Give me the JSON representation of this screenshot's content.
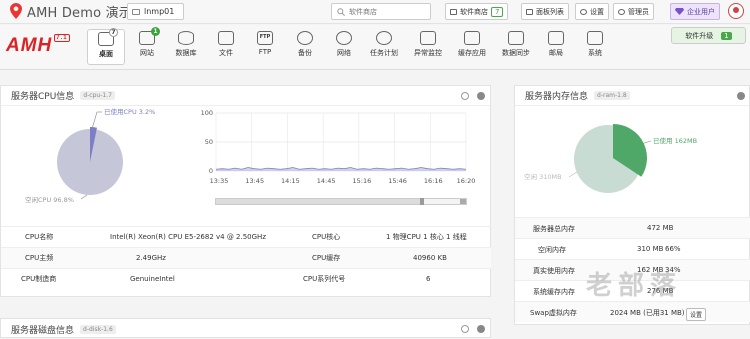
{
  "brand": {
    "title": "AMH Demo 演示"
  },
  "host_select": {
    "value": "lnmp01"
  },
  "search": {
    "placeholder": "软件商店"
  },
  "top_buttons": {
    "store": "软件商店",
    "store_badge": "7",
    "panel_list": "面板列表",
    "settings": "设置",
    "admin": "管理员",
    "enterprise": "企业用户"
  },
  "logo": {
    "text": "AMH",
    "version": "7.1"
  },
  "nav": [
    {
      "label": "桌面",
      "badge": "7"
    },
    {
      "label": "网站",
      "badge": "1"
    },
    {
      "label": "数据库"
    },
    {
      "label": "文件"
    },
    {
      "label": "FTP"
    },
    {
      "label": "备份"
    },
    {
      "label": "网络"
    },
    {
      "label": "任务计划"
    },
    {
      "label": "异常监控"
    },
    {
      "label": "缓存应用"
    },
    {
      "label": "数据同步"
    },
    {
      "label": "邮局"
    },
    {
      "label": "系统"
    }
  ],
  "upgrade": {
    "label": "软件升级",
    "badge": "1"
  },
  "cpu_panel": {
    "title": "服务器CPU信息",
    "tag": "d-cpu-1.7",
    "pie_used_label": "已使用CPU 3.2%",
    "pie_free_label": "空闲CPU 96.8%",
    "rows": [
      {
        "k1": "CPU名称",
        "v1": "Intel(R) Xeon(R) CPU E5-2682 v4 @ 2.50GHz",
        "k2": "CPU核心",
        "v2": "1 物理CPU  1 核心  1 线程"
      },
      {
        "k1": "CPU主频",
        "v1": "2.49GHz",
        "k2": "CPU缓存",
        "v2": "40960 KB"
      },
      {
        "k1": "CPU制造商",
        "v1": "GenuineIntel",
        "k2": "CPU系列代号",
        "v2": "6"
      }
    ]
  },
  "chart_data": {
    "type": "area",
    "x": [
      "13:35",
      "13:45",
      "14:15",
      "14:45",
      "15:16",
      "15:46",
      "16:16",
      "16:20"
    ],
    "x_ticks": [
      "13:35",
      "13:45",
      "14:15",
      "14:45",
      "15:16",
      "15:46",
      "16:16",
      "16:20"
    ],
    "y_ticks": [
      "100",
      "50",
      "0"
    ],
    "ylim": [
      0,
      100
    ],
    "values": [
      3,
      4,
      3,
      5,
      3,
      6,
      4,
      3,
      5,
      4,
      3,
      4,
      6,
      3,
      4,
      5,
      3,
      4,
      3,
      5,
      4,
      6,
      3,
      4,
      3,
      5,
      4,
      3,
      4,
      5,
      3,
      4,
      6,
      4,
      3,
      5,
      4,
      3,
      4,
      3
    ],
    "grid": true,
    "color": "#7c7fc6"
  },
  "ram_panel": {
    "title": "服务器内存信息",
    "tag": "d-ram-1.8",
    "pie_used_label": "已使用 162MB",
    "pie_free_label": "空闲 310MB",
    "used_value": 162,
    "free_value": 310,
    "used_color": "#4fa868",
    "free_color": "#c9dcd4",
    "rows": [
      {
        "k": "服务器总内存",
        "v": "472 MB",
        "p": ""
      },
      {
        "k": "空闲内存",
        "v": "310 MB",
        "p": "66%"
      },
      {
        "k": "真实使用内存",
        "v": "162 MB",
        "p": "34%"
      },
      {
        "k": "系统缓存内存",
        "v": "276 MB",
        "p": ""
      },
      {
        "k": "Swap虚拟内存",
        "v": "2024 MB (已用31 MB)",
        "p": ""
      }
    ],
    "swap_button": "设置"
  },
  "cpu_pie": {
    "used": 3.2,
    "free": 96.8,
    "used_color": "#7c7fc6",
    "free_color": "#c5c6d8"
  },
  "disk_panel": {
    "title": "服务器磁盘信息",
    "tag": "d-disk-1.6"
  },
  "watermark": "老部落"
}
